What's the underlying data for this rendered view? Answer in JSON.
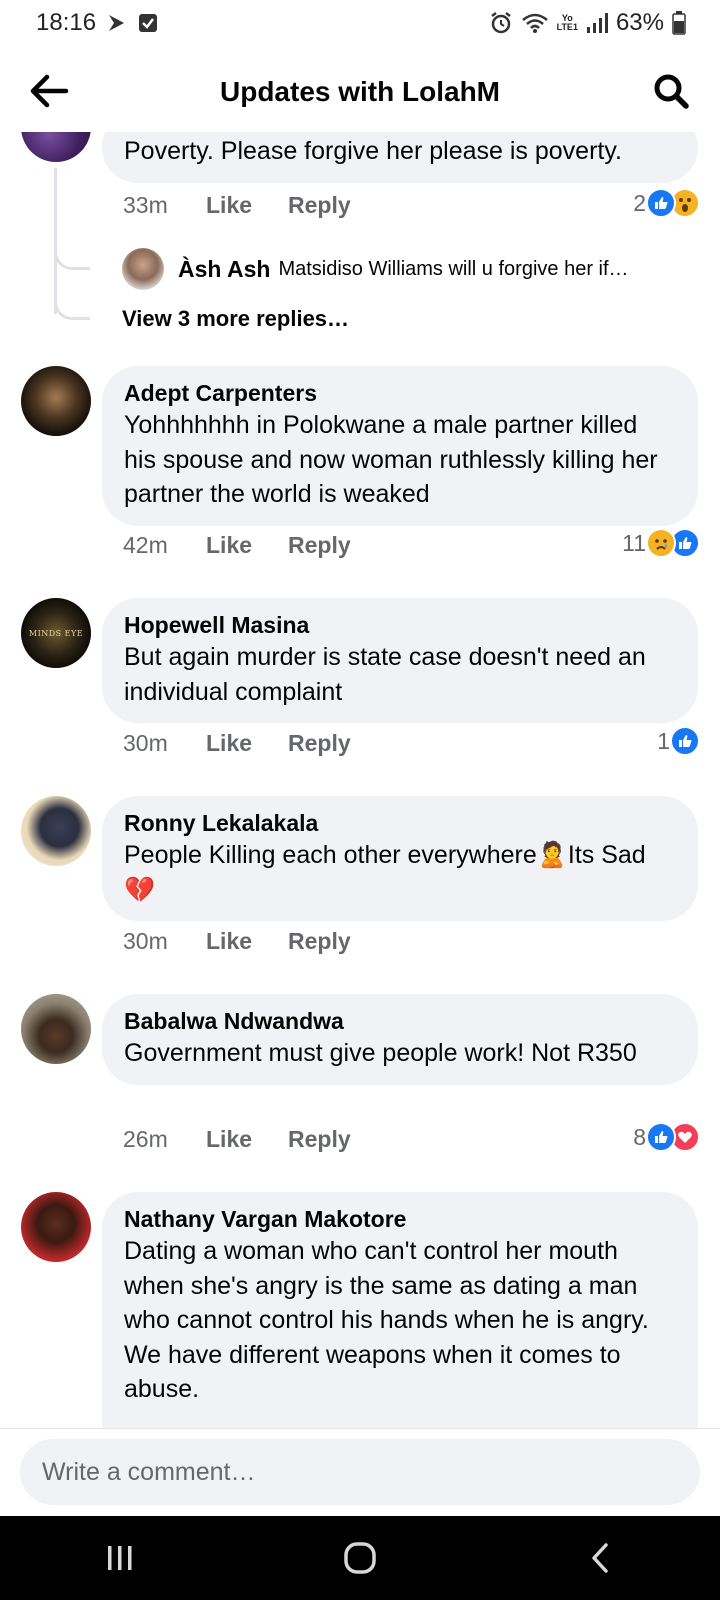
{
  "status_bar": {
    "time": "18:16",
    "battery": "63%",
    "network": "LTE1",
    "carrier": "Yo",
    "icons": [
      "play-icon",
      "check-box-icon",
      "alarm-icon",
      "wifi-icon",
      "signal-icon",
      "battery-icon"
    ]
  },
  "header": {
    "title": "Updates with LolahM",
    "back_icon": "arrow-left-icon",
    "search_icon": "search-icon"
  },
  "thread": {
    "text": "Poverty. Please forgive her please is poverty.",
    "time": "33m",
    "like_label": "Like",
    "reply_label": "Reply",
    "reaction_count": "2",
    "reactions": [
      "like",
      "wow"
    ],
    "reply": {
      "author": "Àsh Ash",
      "text": "Matsidiso Williams will u forgive her if…"
    },
    "more_replies": "View 3 more replies…"
  },
  "comments": [
    {
      "author": "Adept Carpenters",
      "text": "Yohhhhhhh in Polokwane a male partner killed his spouse and now woman ruthlessly killing her partner the world is weaked",
      "time": "42m",
      "like_label": "Like",
      "reply_label": "Reply",
      "reaction_count": "11",
      "reactions": [
        "sad",
        "like"
      ]
    },
    {
      "author": "Hopewell Masina",
      "text": "But again murder is state case doesn't need an individual complaint",
      "time": "30m",
      "like_label": "Like",
      "reply_label": "Reply",
      "reaction_count": "1",
      "reactions": [
        "like"
      ],
      "avatar_text": "MINDS EYE"
    },
    {
      "author": "Ronny Lekalakala",
      "text_part1": "People Killing each other everywhere",
      "emoji1": "🙎",
      "text_part2": "Its Sad",
      "emoji2": "💔",
      "time": "30m",
      "like_label": "Like",
      "reply_label": "Reply"
    },
    {
      "author": "Babalwa Ndwandwa",
      "text": "Government must give people work! Not R350",
      "time": "26m",
      "like_label": "Like",
      "reply_label": "Reply",
      "reaction_count": "8",
      "reactions": [
        "like",
        "love"
      ]
    },
    {
      "author": "Nathany Vargan Makotore",
      "text": "Dating a woman who can't control her mouth when she's angry is the same as dating a man who cannot control his hands when he is angry. We have different weapons when it comes to abuse."
    }
  ],
  "composer": {
    "placeholder": "Write a comment…"
  },
  "nav": {
    "recents_icon": "recents-icon",
    "home_icon": "home-icon",
    "back_icon": "back-chevron-icon"
  },
  "colors": {
    "bubble": "#f0f2f5",
    "meta_text": "#65676b",
    "like_blue": "#1877f2",
    "love_red": "#f33e58",
    "wow_yellow": "#f7b125"
  }
}
